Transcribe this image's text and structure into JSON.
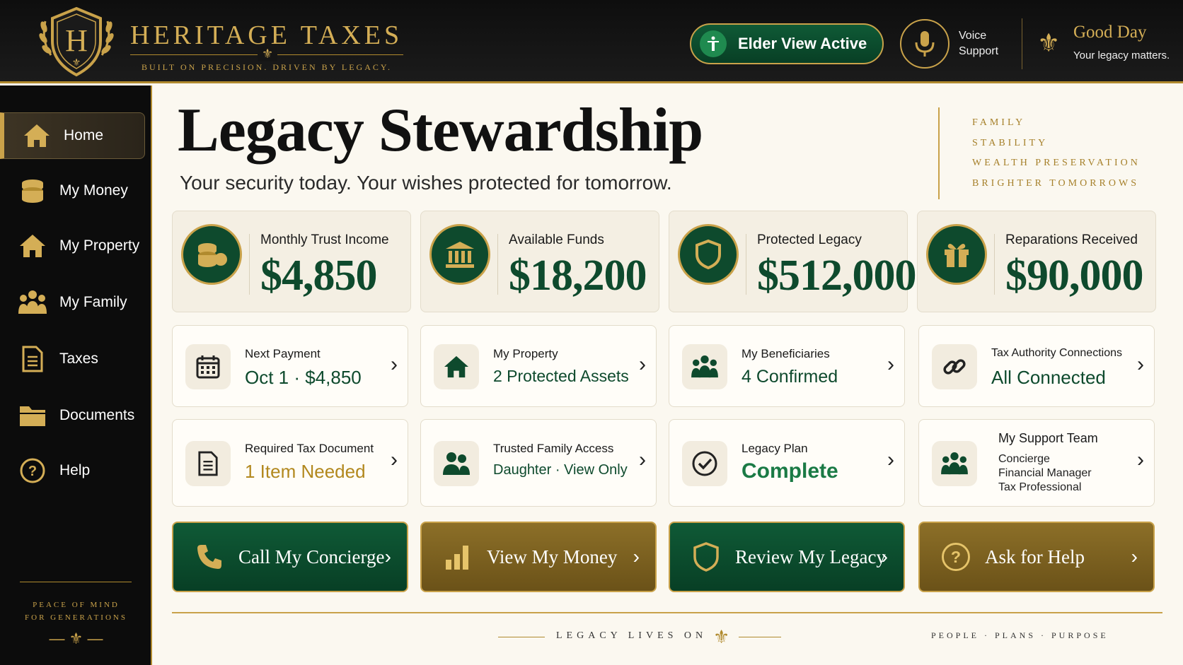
{
  "brand": {
    "name": "HERITAGE TAXES",
    "tagline": "BUILT ON PRECISION. DRIVEN BY LEGACY.",
    "crest_letter": "H"
  },
  "header": {
    "elder_view": "Elder View Active",
    "voice_support": "Voice Support",
    "greeting_title": "Good Day",
    "greeting_sub": "Your legacy matters."
  },
  "sidebar": {
    "items": [
      {
        "label": "Home",
        "icon": "home-icon",
        "active": true
      },
      {
        "label": "My Money",
        "icon": "coins-icon"
      },
      {
        "label": "My Property",
        "icon": "house-icon"
      },
      {
        "label": "My Family",
        "icon": "family-icon"
      },
      {
        "label": "Taxes",
        "icon": "document-icon"
      },
      {
        "label": "Documents",
        "icon": "folder-icon"
      },
      {
        "label": "Help",
        "icon": "help-icon"
      }
    ],
    "footer_line1": "PEACE OF MIND",
    "footer_line2": "FOR GENERATIONS"
  },
  "main": {
    "title": "Legacy Stewardship",
    "subtitle": "Your security today. Your wishes protected for tomorrow.",
    "values": [
      "FAMILY",
      "STABILITY",
      "WEALTH PRESERVATION",
      "BRIGHTER TOMORROWS"
    ]
  },
  "stats": [
    {
      "label": "Monthly Trust Income",
      "value": "$4,850",
      "icon": "coins-icon"
    },
    {
      "label": "Available Funds",
      "value": "$18,200",
      "icon": "bank-icon"
    },
    {
      "label": "Protected Legacy",
      "value": "$512,000",
      "icon": "shield-icon"
    },
    {
      "label": "Reparations Received",
      "value": "$90,000",
      "icon": "gift-icon"
    }
  ],
  "cards": [
    {
      "label": "Next Payment",
      "value": "Oct 1 · $4,850",
      "icon": "calendar-icon"
    },
    {
      "label": "My Property",
      "value": "2 Protected Assets",
      "icon": "house-icon"
    },
    {
      "label": "My Beneficiaries",
      "value": "4 Confirmed",
      "icon": "people-icon"
    },
    {
      "label": "Tax Authority Connections",
      "value": "All Connected",
      "icon": "link-icon"
    },
    {
      "label": "Required Tax Document",
      "value": "1 Item Needed",
      "icon": "document-icon",
      "status_color": "#b2881e"
    },
    {
      "label": "Trusted Family Access",
      "value": "Daughter · View Only",
      "icon": "users-icon"
    },
    {
      "label": "Legacy Plan",
      "value": "Complete",
      "icon": "check-circle-icon"
    },
    {
      "label": "My Support Team",
      "lines": [
        "Concierge",
        "Financial Manager",
        "Tax Professional"
      ],
      "icon": "team-icon"
    }
  ],
  "actions": [
    {
      "label": "Call My Concierge",
      "icon": "phone-icon"
    },
    {
      "label": "View My Money",
      "icon": "bar-chart-icon"
    },
    {
      "label": "Review My Legacy",
      "icon": "shield-icon"
    },
    {
      "label": "Ask for Help",
      "icon": "help-icon"
    }
  ],
  "footer": {
    "legacy": "LEGACY LIVES ON",
    "ppp": "PEOPLE · PLANS · PURPOSE"
  },
  "colors": {
    "gold": "#c9a24a",
    "green": "#0e4a2d",
    "dark": "#0c0c0c",
    "cream": "#fbf8f0",
    "alert": "#b2881e"
  }
}
